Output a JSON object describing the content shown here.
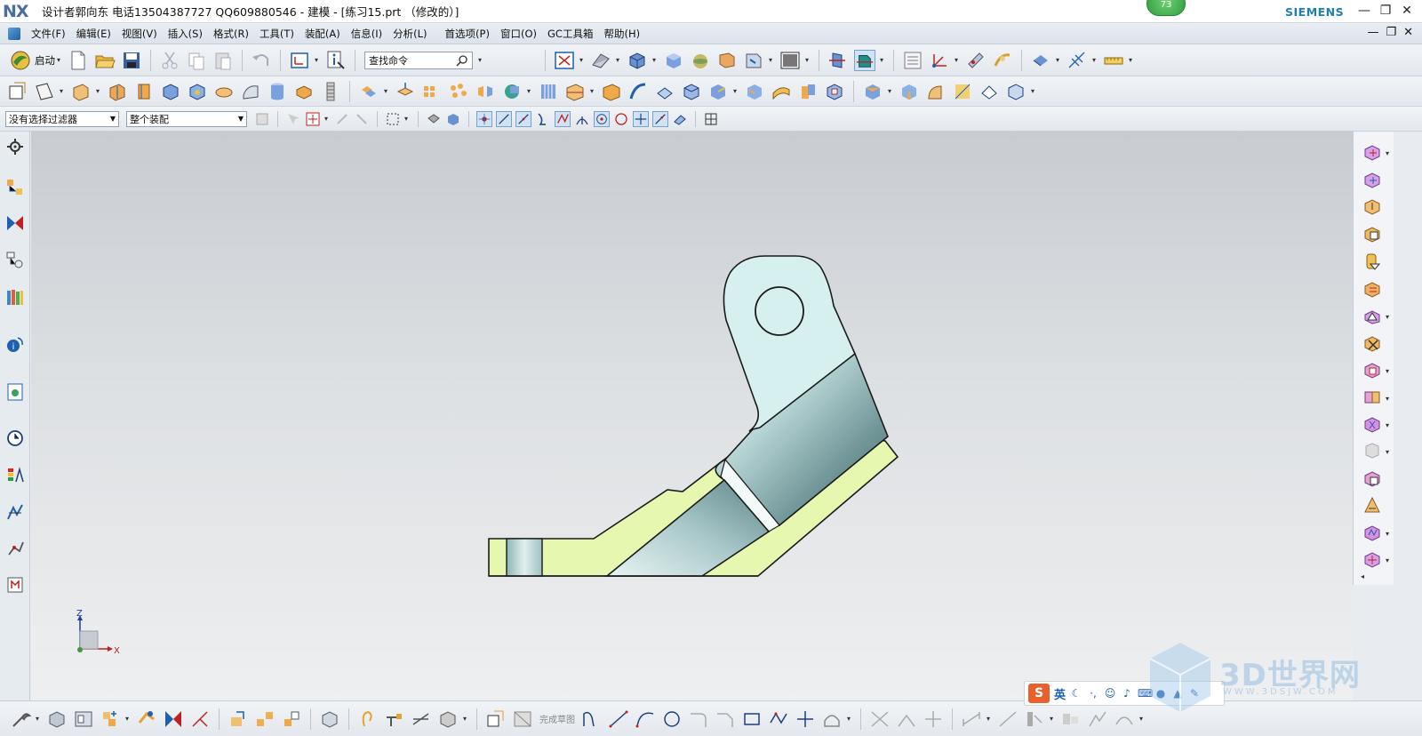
{
  "window": {
    "logo": "NX",
    "title": "设计者郭向东  电话13504387727  QQ609880546 - 建模 - [练习15.prt （修改的）]",
    "brand": "SIEMENS",
    "badge": "73",
    "minimize": "—",
    "restore": "❐",
    "close": "✕"
  },
  "menubar": {
    "items": [
      "文件(F)",
      "编辑(E)",
      "视图(V)",
      "插入(S)",
      "格式(R)",
      "工具(T)",
      "装配(A)",
      "信息(I)",
      "分析(L)",
      "首选项(P)",
      "窗口(O)",
      "GC工具箱",
      "帮助(H)"
    ],
    "doc_minimize": "—",
    "doc_restore": "❐",
    "doc_close": "✕"
  },
  "toolbar1": {
    "start_label": "启动",
    "search_placeholder": "查找命令"
  },
  "toolbar3": {
    "filter_value": "没有选择过滤器",
    "scope_value": "整个装配"
  },
  "triad": {
    "z": "Z",
    "x": "X"
  },
  "bottombar": {
    "finish_sketch": "完成草图"
  },
  "ime": {
    "lang": "英",
    "logo": "S"
  },
  "watermark": {
    "text": "3D世界网",
    "sub": "WWW.3DSJW.COM"
  },
  "colors": {
    "face_light": "#d6efef",
    "face_green": "#e6f7b0",
    "cylinder_dark": "#7fa7a8",
    "outline": "#1a1a1a"
  }
}
